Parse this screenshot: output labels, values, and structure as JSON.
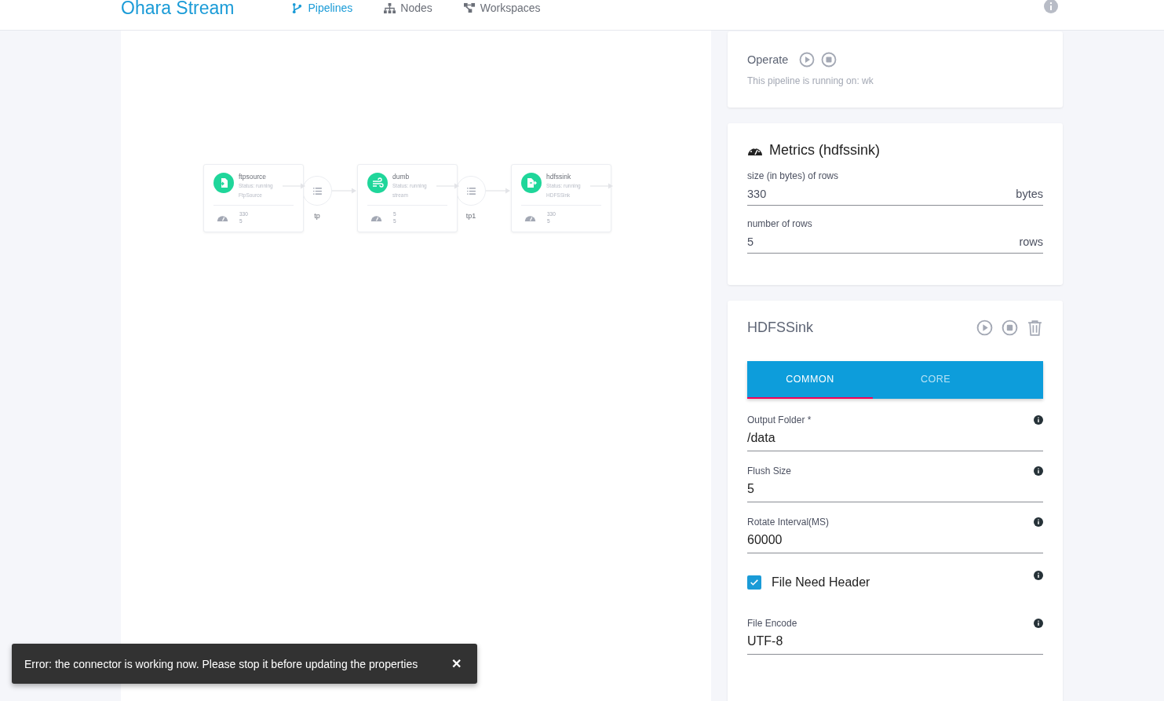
{
  "header": {
    "logo": "Ohara Stream",
    "nav": [
      {
        "label": "Pipelines",
        "selected": true,
        "kind": "branch"
      },
      {
        "label": "Nodes",
        "selected": false,
        "kind": "tree"
      },
      {
        "label": "Workspaces",
        "selected": false,
        "kind": "workspace"
      }
    ]
  },
  "graph": {
    "nodes": [
      {
        "kind": "source",
        "name": "ftpsource",
        "status": "Status: running",
        "type": "FtpSource",
        "metrics": [
          "330",
          "5"
        ]
      },
      {
        "kind": "topic",
        "name": "tp"
      },
      {
        "kind": "stream",
        "name": "dumb",
        "status": "Status: running",
        "type": "stream",
        "metrics": [
          "5",
          "5"
        ]
      },
      {
        "kind": "topic",
        "name": "tp1"
      },
      {
        "kind": "sink",
        "name": "hdfssink",
        "status": "Status: running",
        "type": "HDFSSink",
        "metrics": [
          "330",
          "5"
        ]
      }
    ]
  },
  "operate": {
    "title": "Operate",
    "text": "This pipeline is running on: wk"
  },
  "metrics": {
    "title": "Metrics (hdfssink)",
    "fields": [
      {
        "label": "size (in bytes) of rows",
        "value": "330",
        "unit": "bytes"
      },
      {
        "label": "number of rows",
        "value": "5",
        "unit": "rows"
      }
    ]
  },
  "connector": {
    "title": "HDFSSink",
    "tabs": [
      {
        "label": "COMMON",
        "selected": true
      },
      {
        "label": "CORE",
        "selected": false
      }
    ],
    "fields": [
      {
        "kind": "text",
        "label": "Output Folder *",
        "value": "/data"
      },
      {
        "kind": "text",
        "label": "Flush Size",
        "value": "5"
      },
      {
        "kind": "text",
        "label": "Rotate Interval(MS)",
        "value": "60000"
      },
      {
        "kind": "checkbox",
        "label": "File Need Header",
        "checked": true
      },
      {
        "kind": "text",
        "label": "File Encode",
        "value": "UTF-8"
      }
    ]
  },
  "snackbar": {
    "message": "Error: the connector is working now. Please stop it before updating the properties",
    "close": "✕"
  }
}
